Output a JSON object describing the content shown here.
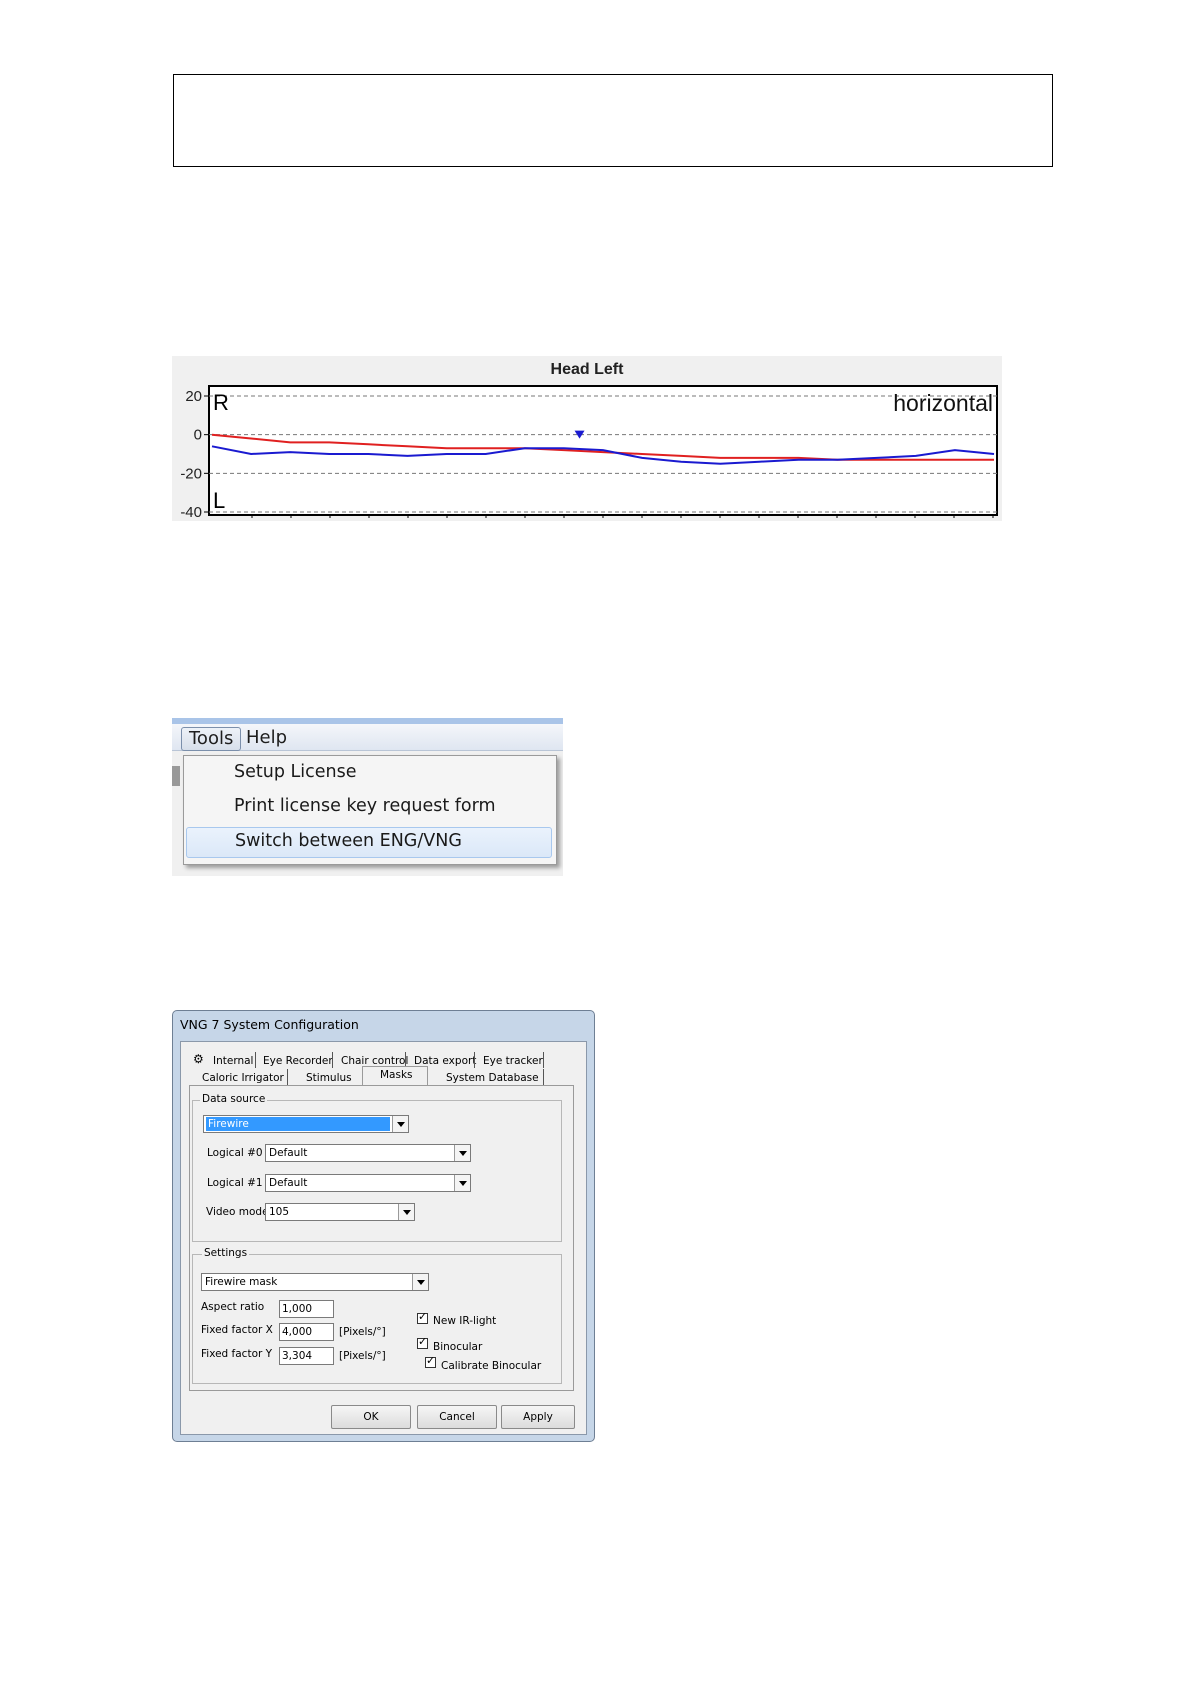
{
  "chart_data": {
    "type": "line",
    "title": "Head Left",
    "annotation": "horizontal",
    "top_label": "R",
    "bottom_label": "L",
    "ylim": [
      -40,
      20
    ],
    "yticks": [
      20,
      0,
      -20,
      -40
    ],
    "grid": "dashed horizontal",
    "series": [
      {
        "color": "#e02020",
        "x": [
          0,
          5,
          10,
          15,
          20,
          25,
          30,
          35,
          40,
          45,
          50,
          55,
          60,
          65,
          70,
          75,
          80,
          85,
          90,
          95,
          100
        ],
        "values": [
          0,
          -2,
          -4,
          -4,
          -5,
          -6,
          -7,
          -7,
          -7,
          -8,
          -9,
          -10,
          -11,
          -12,
          -12,
          -12,
          -13,
          -13,
          -13,
          -13,
          -13
        ]
      },
      {
        "color": "#1a1ad0",
        "x": [
          0,
          5,
          10,
          15,
          20,
          25,
          30,
          35,
          40,
          45,
          50,
          55,
          60,
          65,
          70,
          75,
          80,
          85,
          90,
          95,
          100
        ],
        "values": [
          -6,
          -10,
          -9,
          -10,
          -10,
          -11,
          -10,
          -10,
          -7,
          -7,
          -8,
          -12,
          -14,
          -15,
          -14,
          -13,
          -13,
          -12,
          -11,
          -8,
          -10
        ]
      }
    ],
    "marker": {
      "x": 47,
      "y": -1,
      "color": "#1a1ad0"
    }
  },
  "menu": {
    "bar_items": [
      "Tools",
      "Help"
    ],
    "items": [
      "Setup License",
      "Print license key request form",
      "Switch between ENG/VNG"
    ]
  },
  "dialog": {
    "title": "VNG 7 System Configuration",
    "tabs_row1": [
      "Internal",
      "Eye Recorder",
      "Chair control",
      "Data export",
      "Eye tracker"
    ],
    "tabs_row2": [
      "Caloric Irrigator",
      "Stimulus",
      "Masks",
      "System Database"
    ],
    "active_tab": "Masks",
    "data_source": {
      "title": "Data source",
      "source_value": "Firewire",
      "logical0_label": "Logical #0",
      "logical0_value": "Default",
      "logical1_label": "Logical #1",
      "logical1_value": "Default",
      "video_mode_label": "Video mode",
      "video_mode_value": "105"
    },
    "settings": {
      "title": "Settings",
      "mask_value": "Firewire mask",
      "aspect_ratio_label": "Aspect ratio",
      "aspect_ratio_value": "1,000",
      "fixed_x_label": "Fixed factor X",
      "fixed_x_value": "4,000",
      "fixed_x_unit": "[Pixels/°]",
      "fixed_y_label": "Fixed factor Y",
      "fixed_y_value": "3,304",
      "fixed_y_unit": "[Pixels/°]",
      "new_ir_light": "New IR-light",
      "binocular": "Binocular",
      "calibrate_binocular": "Calibrate Binocular"
    },
    "buttons": {
      "ok": "OK",
      "cancel": "Cancel",
      "apply": "Apply"
    }
  }
}
